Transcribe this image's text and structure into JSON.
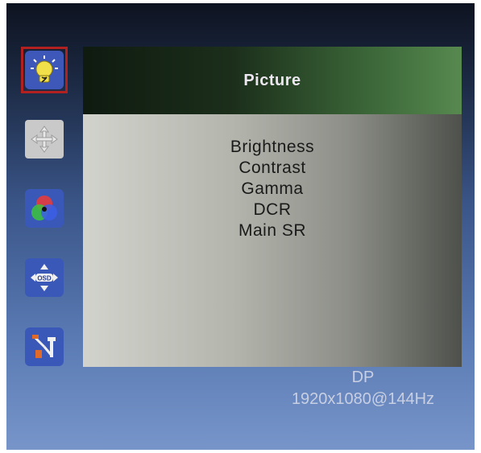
{
  "sidebar": {
    "items": [
      {
        "icon": "lightbulb-icon",
        "active": true
      },
      {
        "icon": "position-arrows-icon",
        "active": false
      },
      {
        "icon": "color-circles-icon",
        "active": false
      },
      {
        "icon": "osd-arrows-icon",
        "active": false
      },
      {
        "icon": "tools-icon",
        "active": false
      }
    ],
    "osd_icon_label": "OSD",
    "active_border_color": "#b32020"
  },
  "panel": {
    "title": "Picture",
    "menu": [
      "Brightness",
      "Contrast",
      "Gamma",
      "DCR",
      "Main SR"
    ]
  },
  "status": {
    "input": "DP",
    "resolution": "1920x1080@144Hz"
  }
}
